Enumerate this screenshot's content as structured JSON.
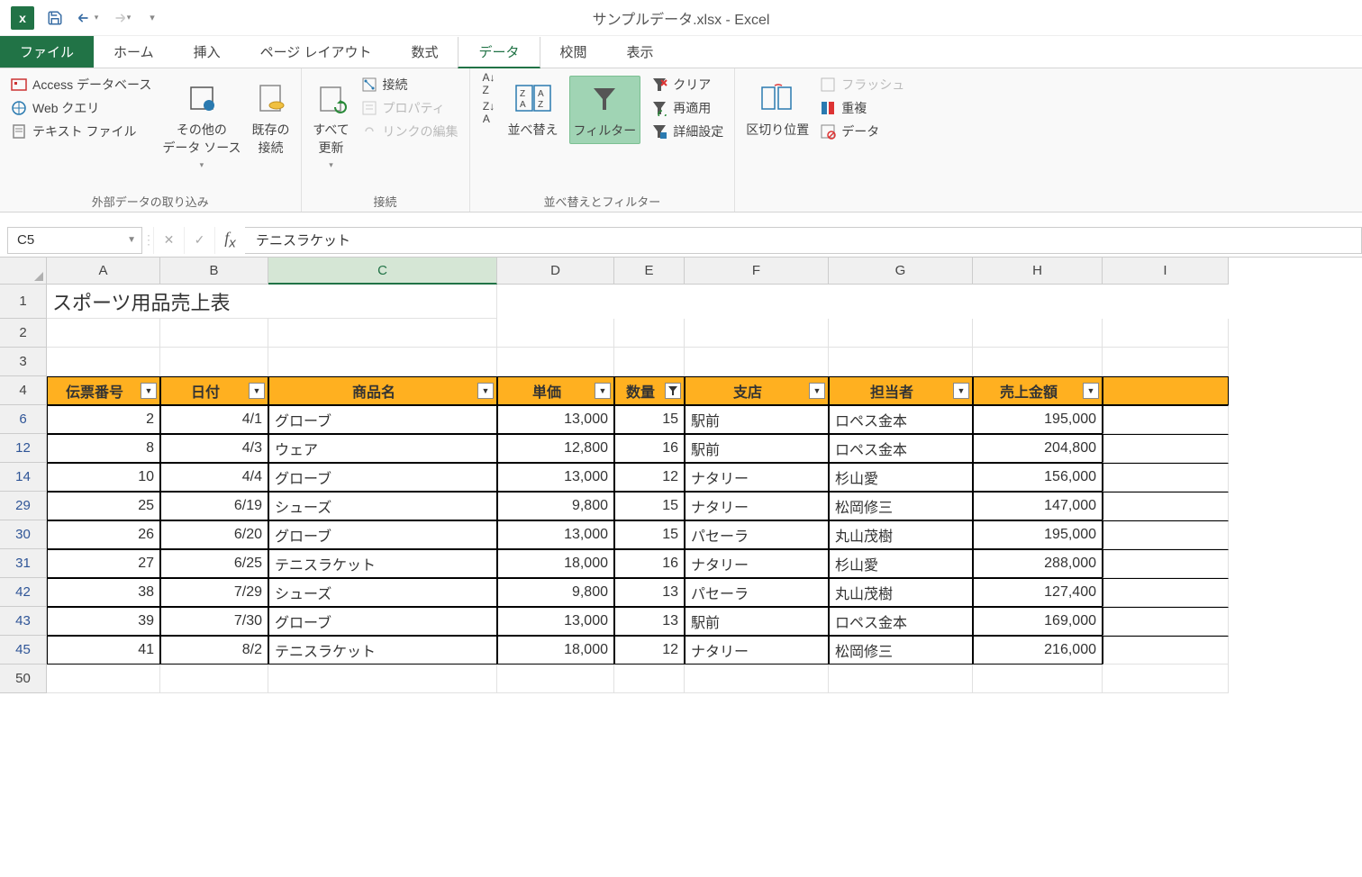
{
  "window": {
    "title": "サンプルデータ.xlsx - Excel"
  },
  "tabs": {
    "file": "ファイル",
    "home": "ホーム",
    "insert": "挿入",
    "page_layout": "ページ レイアウト",
    "formulas": "数式",
    "data": "データ",
    "review": "校閲",
    "view": "表示"
  },
  "ribbon": {
    "group_external": "外部データの取り込み",
    "access": "Access データベース",
    "web": "Web クエリ",
    "text": "テキスト ファイル",
    "other_sources": "その他の\nデータ ソース",
    "existing_conn": "既存の\n接続",
    "group_connections": "接続",
    "refresh_all": "すべて\n更新",
    "connections": "接続",
    "properties": "プロパティ",
    "edit_links": "リンクの編集",
    "group_sort": "並べ替えとフィルター",
    "sort": "並べ替え",
    "filter": "フィルター",
    "clear": "クリア",
    "reapply": "再適用",
    "advanced": "詳細設定",
    "text_to_cols": "区切り位置",
    "flash_fill": "フラッシュ",
    "remove_dup": "重複",
    "data_val": "データ"
  },
  "formula_bar": {
    "namebox": "C5",
    "value": "テニスラケット"
  },
  "columns": [
    "A",
    "B",
    "C",
    "D",
    "E",
    "F",
    "G",
    "H",
    "I"
  ],
  "title_cell": "スポーツ用品売上表",
  "headers": [
    "伝票番号",
    "日付",
    "商品名",
    "単価",
    "数量",
    "支店",
    "担当者",
    "売上金額"
  ],
  "row_numbers": [
    "1",
    "2",
    "3",
    "4",
    "6",
    "12",
    "14",
    "29",
    "30",
    "31",
    "42",
    "43",
    "45",
    "50"
  ],
  "rows": [
    {
      "n": "2",
      "date": "4/1",
      "prod": "グローブ",
      "price": "13,000",
      "qty": "15",
      "store": "駅前",
      "staff": "ロペス金本",
      "amt": "195,000"
    },
    {
      "n": "8",
      "date": "4/3",
      "prod": "ウェア",
      "price": "12,800",
      "qty": "16",
      "store": "駅前",
      "staff": "ロペス金本",
      "amt": "204,800"
    },
    {
      "n": "10",
      "date": "4/4",
      "prod": "グローブ",
      "price": "13,000",
      "qty": "12",
      "store": "ナタリー",
      "staff": "杉山愛",
      "amt": "156,000"
    },
    {
      "n": "25",
      "date": "6/19",
      "prod": "シューズ",
      "price": "9,800",
      "qty": "15",
      "store": "ナタリー",
      "staff": "松岡修三",
      "amt": "147,000"
    },
    {
      "n": "26",
      "date": "6/20",
      "prod": "グローブ",
      "price": "13,000",
      "qty": "15",
      "store": "パセーラ",
      "staff": "丸山茂樹",
      "amt": "195,000"
    },
    {
      "n": "27",
      "date": "6/25",
      "prod": "テニスラケット",
      "price": "18,000",
      "qty": "16",
      "store": "ナタリー",
      "staff": "杉山愛",
      "amt": "288,000"
    },
    {
      "n": "38",
      "date": "7/29",
      "prod": "シューズ",
      "price": "9,800",
      "qty": "13",
      "store": "パセーラ",
      "staff": "丸山茂樹",
      "amt": "127,400"
    },
    {
      "n": "39",
      "date": "7/30",
      "prod": "グローブ",
      "price": "13,000",
      "qty": "13",
      "store": "駅前",
      "staff": "ロペス金本",
      "amt": "169,000"
    },
    {
      "n": "41",
      "date": "8/2",
      "prod": "テニスラケット",
      "price": "18,000",
      "qty": "12",
      "store": "ナタリー",
      "staff": "松岡修三",
      "amt": "216,000"
    }
  ]
}
